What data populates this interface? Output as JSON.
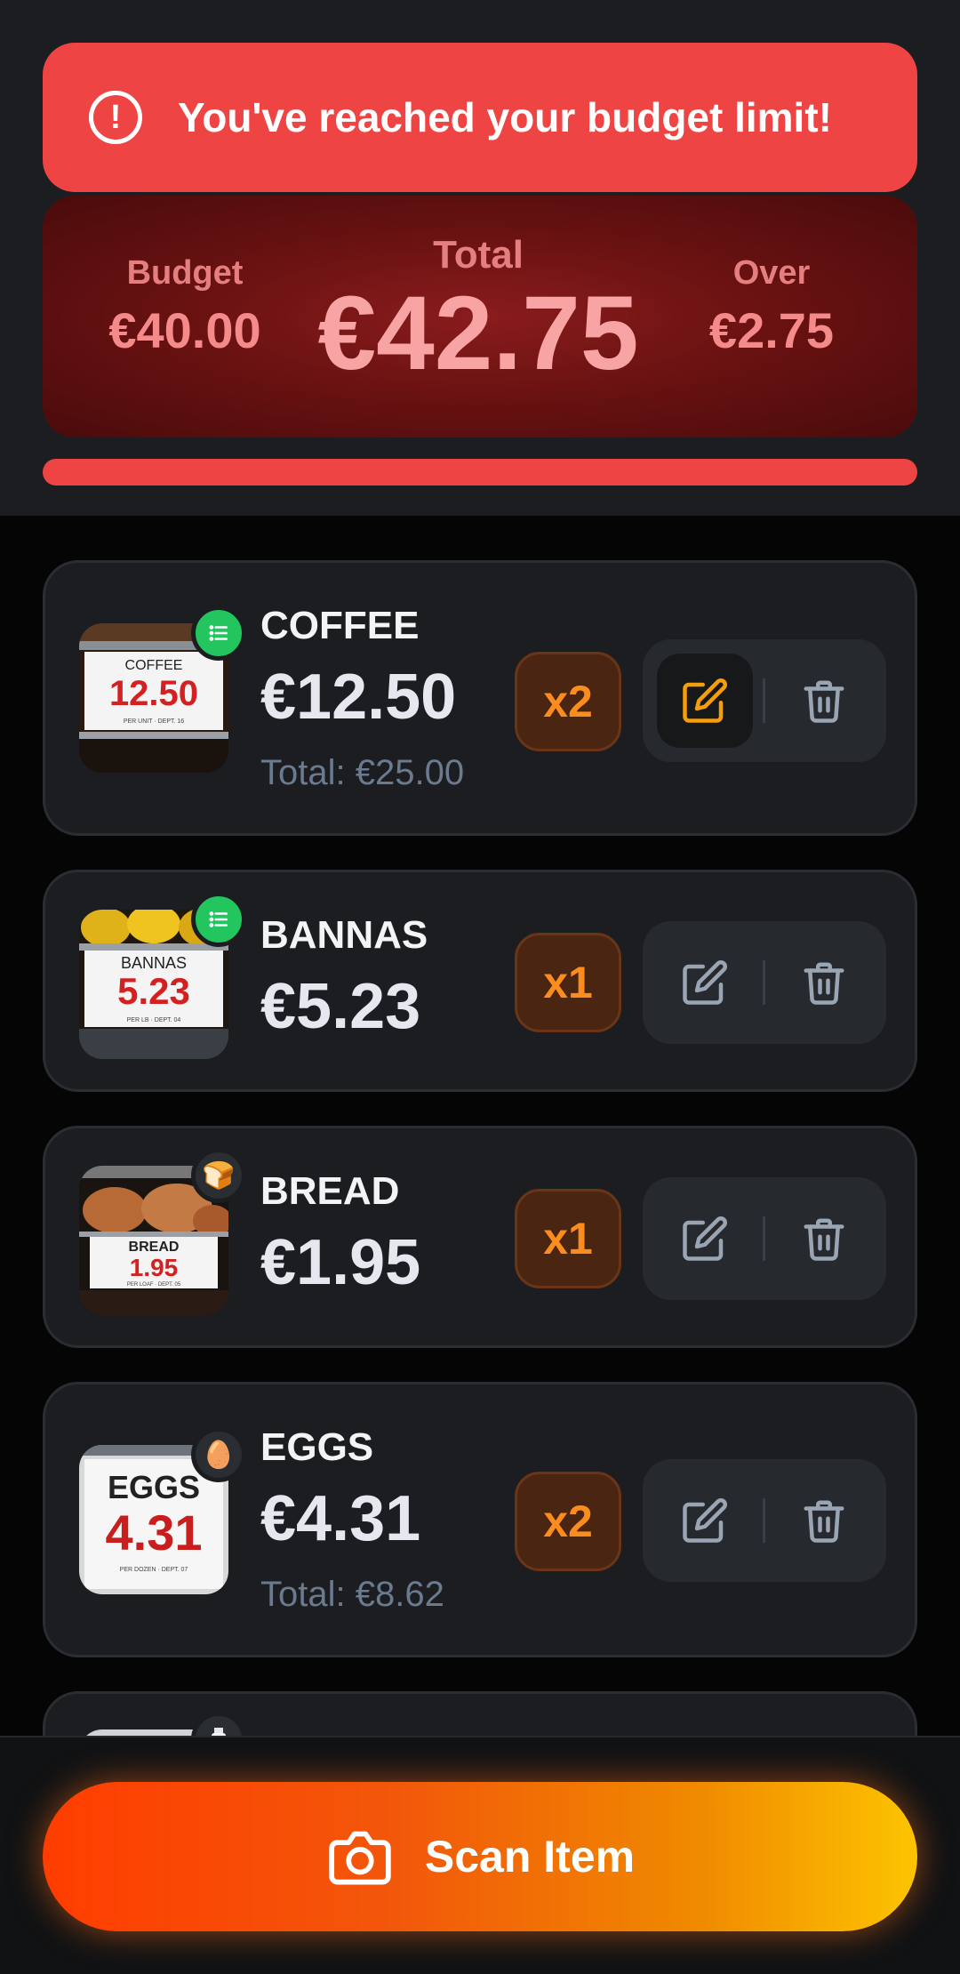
{
  "alert": {
    "icon": "alert-circle-icon",
    "message": "You've reached your budget limit!"
  },
  "summary": {
    "budget_label": "Budget",
    "budget_value": "€40.00",
    "total_label": "Total",
    "total_value": "€42.75",
    "over_label": "Over",
    "over_value": "€2.75"
  },
  "budget_progress": 1.0,
  "items": [
    {
      "name": "COFFEE",
      "price": "€12.50",
      "total": "Total: €25.00",
      "qty": "x2",
      "label_name": "COFFEE",
      "label_price": "12.50",
      "label_sub": "PER UNIT · DEPT. 16",
      "badge_icon": "list-icon"
    },
    {
      "name": "BANNAS",
      "price": "€5.23",
      "qty": "x1",
      "label_name": "BANNAS",
      "label_price": "5.23",
      "label_sub": "PER LB · DEPT. 04",
      "badge_icon": "list-icon"
    },
    {
      "name": "BREAD",
      "price": "€1.95",
      "qty": "x1",
      "label_name": "BREAD",
      "label_price": "1.95",
      "label_sub": "PER LOAF · DEPT. 05",
      "badge_icon": "bread-icon",
      "badge_glyph": "🍞"
    },
    {
      "name": "EGGS",
      "price": "€4.31",
      "total": "Total: €8.62",
      "qty": "x2",
      "label_name": "EGGS",
      "label_price": "4.31",
      "label_sub": "PER DOZEN · DEPT. 07",
      "badge_icon": "egg-icon",
      "badge_glyph": "🥚"
    }
  ],
  "scan_button": {
    "label": "Scan Item",
    "icon": "camera-icon"
  },
  "colors": {
    "alert": "#ef4444",
    "qty_text": "#fb8c1e",
    "edit_active": "#f59e0b",
    "badge_green": "#22c55e"
  }
}
